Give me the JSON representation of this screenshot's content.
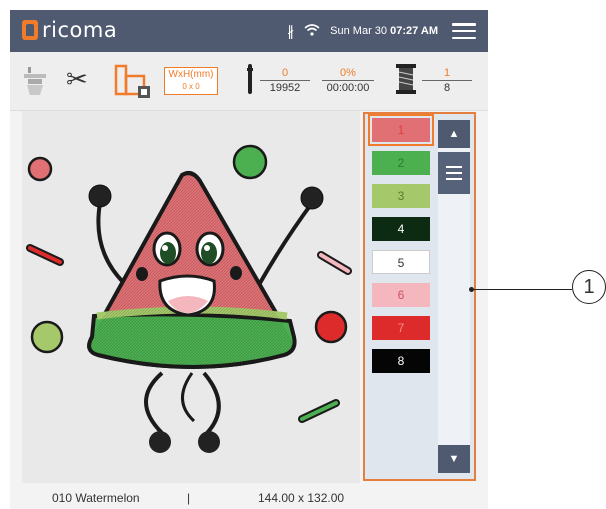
{
  "header": {
    "logo_text": "ricoma",
    "bluetooth_icon": "bluetooth-icon",
    "wifi_icon": "wifi-icon",
    "date": "Sun Mar 30",
    "time": "07:27 AM",
    "menu_icon": "hamburger-menu-icon",
    "bg_color": "#4f5a70",
    "accent_color": "#f07c2b"
  },
  "toolbar": {
    "size_label": "WxH(mm)",
    "size_value": "0 x 0",
    "stitch_current": "0",
    "stitch_total": "19952",
    "progress_percent": "0%",
    "progress_time": "00:00:00",
    "color_current": "1",
    "color_total": "8"
  },
  "colors": [
    {
      "label": "1",
      "color": "#e07074",
      "text_color": "#e04040"
    },
    {
      "label": "2",
      "color": "#4caf50",
      "text_color": "#2e7d32"
    },
    {
      "label": "3",
      "color": "#a5c96a",
      "text_color": "#5a7a2a"
    },
    {
      "label": "4",
      "color": "#0d2a12",
      "text_color": "#ffffff"
    },
    {
      "label": "5",
      "color": "#ffffff",
      "text_color": "#333333"
    },
    {
      "label": "6",
      "color": "#f4b7bd",
      "text_color": "#d05060"
    },
    {
      "label": "7",
      "color": "#dd2b2b",
      "text_color": "#ff8888"
    },
    {
      "label": "8",
      "color": "#050505",
      "text_color": "#ffffff"
    }
  ],
  "status": {
    "design_name": "010 Watermelon",
    "separator": "|",
    "design_size": "144.00 x 132.00"
  },
  "callout": {
    "number": "1"
  }
}
